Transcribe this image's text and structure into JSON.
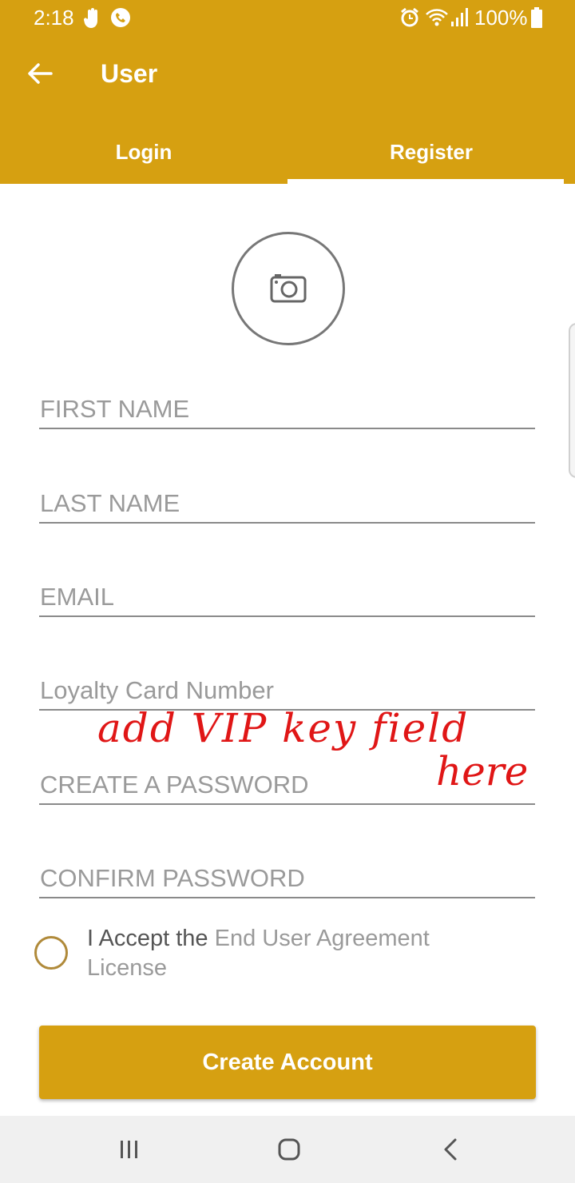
{
  "status_bar": {
    "time": "2:18",
    "battery": "100%"
  },
  "app_bar": {
    "title": "User",
    "tabs": [
      {
        "label": "Login",
        "selected": false
      },
      {
        "label": "Register",
        "selected": true
      }
    ]
  },
  "form": {
    "fields": [
      {
        "placeholder": "FIRST NAME",
        "value": ""
      },
      {
        "placeholder": "LAST NAME",
        "value": ""
      },
      {
        "placeholder": "EMAIL",
        "value": ""
      },
      {
        "placeholder": "Loyalty Card Number",
        "value": ""
      },
      {
        "placeholder": "CREATE A PASSWORD",
        "value": ""
      },
      {
        "placeholder": "CONFIRM PASSWORD",
        "value": ""
      }
    ],
    "agreement_prefix": "I Accept the",
    "agreement_link": "End User Agreement License",
    "submit_label": "Create Account"
  },
  "annotation": {
    "line1": "add VIP key field",
    "line2": "here"
  },
  "colors": {
    "brand": "#d6a011",
    "annotation": "#e01616"
  }
}
